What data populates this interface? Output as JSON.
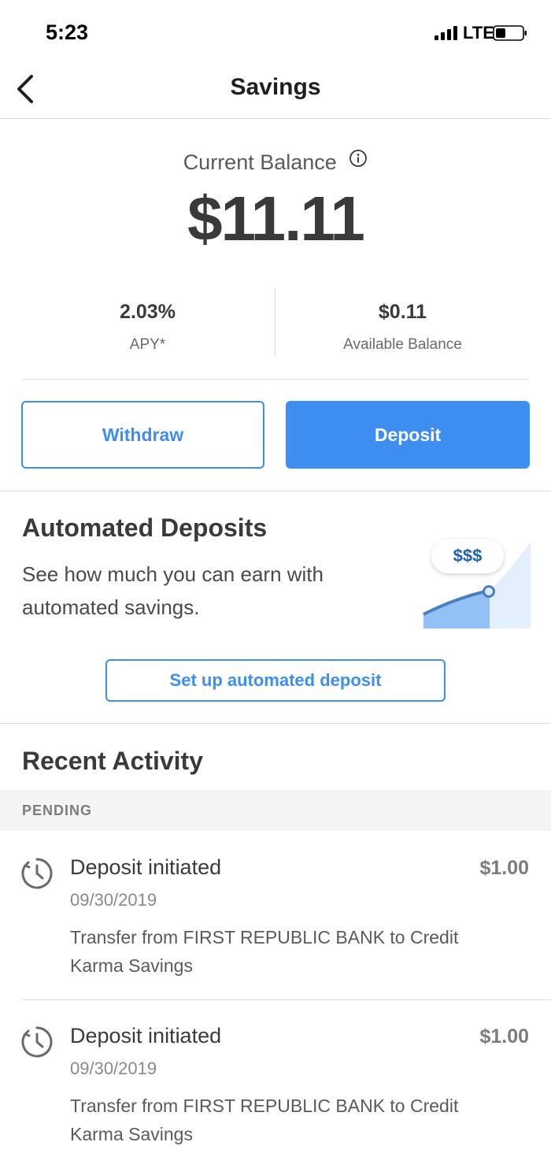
{
  "status_bar": {
    "time": "5:23",
    "network": "LTE"
  },
  "nav": {
    "title": "Savings"
  },
  "balance": {
    "label": "Current Balance",
    "amount": "$11.11"
  },
  "stats": {
    "apy_value": "2.03%",
    "apy_label": "APY*",
    "available_value": "$0.11",
    "available_label": "Available Balance"
  },
  "actions": {
    "withdraw": "Withdraw",
    "deposit": "Deposit"
  },
  "automated": {
    "title": "Automated Deposits",
    "description": "See how much you can earn with automated savings.",
    "bubble": "$$$",
    "button": "Set up automated deposit"
  },
  "recent": {
    "title": "Recent Activity",
    "section_label": "PENDING",
    "items": [
      {
        "title": "Deposit initiated",
        "amount": "$1.00",
        "date": "09/30/2019",
        "description": "Transfer from FIRST REPUBLIC BANK to Credit Karma Savings"
      },
      {
        "title": "Deposit initiated",
        "amount": "$1.00",
        "date": "09/30/2019",
        "description": "Transfer from FIRST REPUBLIC BANK to Credit Karma Savings"
      }
    ]
  },
  "colors": {
    "accent": "#3e8ef2",
    "text": "#3a3a3c",
    "muted": "#7c7c7e",
    "divider": "#dcdcdd"
  }
}
